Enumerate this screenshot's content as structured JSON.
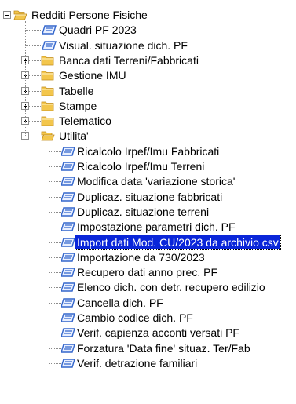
{
  "colors": {
    "folder": "#f3c64c",
    "folder_edge": "#c08a1a",
    "doc": "#3366cc",
    "selection": "#0a26d9"
  },
  "tree": {
    "root": {
      "label": "Redditi Persone Fisiche",
      "icon": "folder-open-icon",
      "expanded": true
    },
    "items": [
      {
        "label": "Quadri PF 2023",
        "type": "leaf",
        "icon": "document-icon"
      },
      {
        "label": "Visual. situazione dich. PF",
        "type": "leaf",
        "icon": "document-icon"
      },
      {
        "label": "Banca dati Terreni/Fabbricati",
        "type": "folder",
        "expanded": false,
        "icon": "folder-icon"
      },
      {
        "label": "Gestione IMU",
        "type": "folder",
        "expanded": false,
        "icon": "folder-icon"
      },
      {
        "label": "Tabelle",
        "type": "folder",
        "expanded": false,
        "icon": "folder-icon"
      },
      {
        "label": "Stampe",
        "type": "folder",
        "expanded": false,
        "icon": "folder-icon"
      },
      {
        "label": "Telematico",
        "type": "folder",
        "expanded": false,
        "icon": "folder-icon"
      },
      {
        "label": "Utilita'",
        "type": "folder",
        "expanded": true,
        "icon": "folder-open-icon",
        "children": [
          {
            "label": "Ricalcolo Irpef/Imu Fabbricati"
          },
          {
            "label": "Ricalcolo Irpef/Imu Terreni"
          },
          {
            "label": "Modifica data 'variazione storica'"
          },
          {
            "label": "Duplicaz. situazione fabbricati"
          },
          {
            "label": "Duplicaz. situazione terreni"
          },
          {
            "label": "Impostazione parametri dich. PF"
          },
          {
            "label": "Import dati Mod. CU/2023 da archivio csv",
            "selected": true
          },
          {
            "label": "Importazione da 730/2023"
          },
          {
            "label": "Recupero dati anno prec. PF"
          },
          {
            "label": "Elenco dich. con detr. recupero edilizio"
          },
          {
            "label": "Cancella dich. PF"
          },
          {
            "label": "Cambio codice dich. PF"
          },
          {
            "label": "Verif. capienza acconti versati PF"
          },
          {
            "label": "Forzatura 'Data fine' situaz. Ter/Fab"
          },
          {
            "label": "Verif. detrazione familiari"
          }
        ]
      }
    ]
  }
}
